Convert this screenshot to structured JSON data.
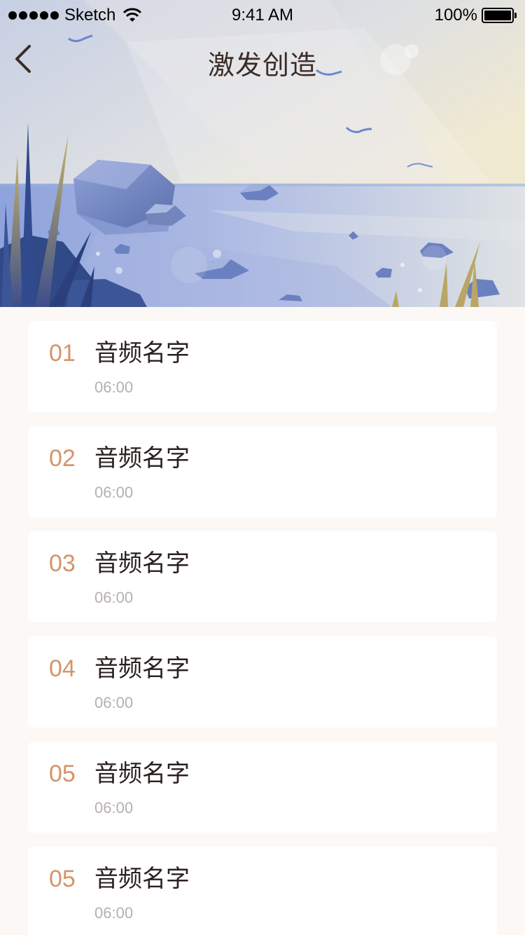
{
  "status_bar": {
    "carrier": "Sketch",
    "time": "9:41 AM",
    "battery": "100%",
    "signal_icon": "signal-dots-icon",
    "wifi_icon": "wifi-icon",
    "battery_icon": "battery-icon"
  },
  "nav": {
    "title": "激发创造",
    "back_icon": "chevron-left-icon"
  },
  "hero": {
    "illustration": "lake-rocks-reeds-birds-illustration"
  },
  "tracks": [
    {
      "number": "01",
      "name": "音频名字",
      "duration": "06:00"
    },
    {
      "number": "02",
      "name": "音频名字",
      "duration": "06:00"
    },
    {
      "number": "03",
      "name": "音频名字",
      "duration": "06:00"
    },
    {
      "number": "04",
      "name": "音频名字",
      "duration": "06:00"
    },
    {
      "number": "05",
      "name": "音频名字",
      "duration": "06:00"
    },
    {
      "number": "05",
      "name": "音频名字",
      "duration": "06:00"
    }
  ],
  "colors": {
    "page_background": "#fbf8f6",
    "card_background": "#ffffff",
    "accent_number": "#d4946a",
    "title_text": "#3a2c27",
    "track_name": "#2a2120",
    "duration_text": "#b6b0ad"
  }
}
